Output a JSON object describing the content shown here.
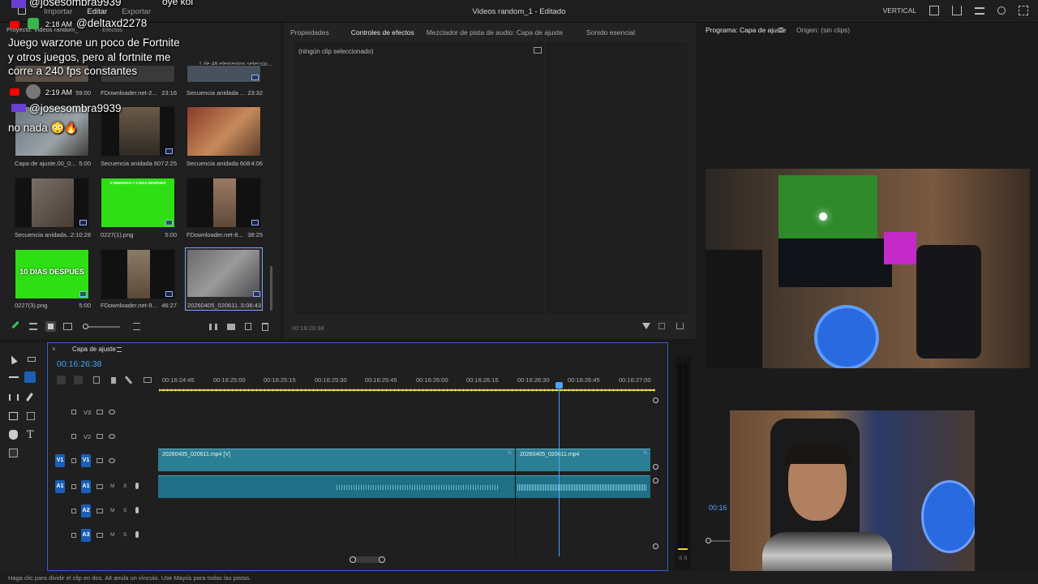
{
  "app": {
    "menu": [
      "Importar",
      "Editar",
      "Exportar"
    ],
    "title": "Videos random_1 - Editado",
    "workspace": "VERTICAL"
  },
  "chat": {
    "lines": [
      {
        "user": "@josesombra9939",
        "text": "oye koi"
      },
      {
        "time": "2:18 AM",
        "user": "@deltaxd2278"
      },
      {
        "text": "Juego warzone un poco de Fortnite"
      },
      {
        "text": "y otros juegos, pero al fortnite me"
      },
      {
        "text": "corre a 240 fps constantes"
      },
      {
        "time": "2:19 AM"
      },
      {
        "user": "@josesombra9939"
      },
      {
        "text": "no nada 😳🔥"
      }
    ]
  },
  "project": {
    "tab1": "Proyecto: Videos random_",
    "tab2": "Efectos",
    "count": "1 de 48 elementos seleccio...",
    "items": [
      {
        "name": "",
        "dur": "59:00"
      },
      {
        "name": "FDownloader.net-2...",
        "dur": "23:16"
      },
      {
        "name": "Secuencia anidada ...",
        "dur": "23:32"
      },
      {
        "name": "Capa de ajuste.00_0...",
        "dur": "5:00"
      },
      {
        "name": "Secuencia anidada 607",
        "dur": "2:25"
      },
      {
        "name": "Secuencia anidada 608",
        "dur": "4:06"
      },
      {
        "name": "Secuencia anidada...",
        "dur": "2:10:28"
      },
      {
        "name": "0227(1).png",
        "dur": "5:00"
      },
      {
        "name": "FDownloader.net-8...",
        "dur": "38:25"
      },
      {
        "name": "0227(3).png",
        "dur": "5:00"
      },
      {
        "name": "FDownloader.net-9...",
        "dur": "46:27"
      },
      {
        "name": "20260405_020611...",
        "dur": "5:06:43"
      }
    ],
    "thumb_text_1": "3 SEMANAS Y 4 DIAS DESPUES",
    "thumb_text_2": "10 DIAS DESPUES"
  },
  "effects": {
    "tabs": [
      "Propiedades",
      "Controles de efectos",
      "Mezclador de pista de audio: Capa de ajuste",
      "Sonido esencial"
    ],
    "no_clip": "(ningún clip seleccionado)",
    "timecode": "00:16:26:38"
  },
  "program": {
    "tab": "Programa: Capa de ajuste",
    "source": "Origen: (sin clips)",
    "timecode_partial": "00:16"
  },
  "timeline": {
    "sequence": "Capa de ajuste",
    "timecode": "00:16:26:38",
    "ruler": [
      "00:16:24:45",
      "00:16:25:00",
      "00:16:25:15",
      "00:16:25:30",
      "00:16:25:45",
      "00:16:26:00",
      "00:16:26:15",
      "00:16:26:30",
      "00:16:26:45",
      "00:16:27:00"
    ],
    "tracks": [
      "V3",
      "V2",
      "V1",
      "A1",
      "A2",
      "A3"
    ],
    "clip1": "20260405_020611.mp4 [V]",
    "clip2": "20260405_020611.mp4"
  },
  "status": "Haga clic para dividir el clip en dos. Alt anula un vínculo. Use Mayús para todas las pistas."
}
